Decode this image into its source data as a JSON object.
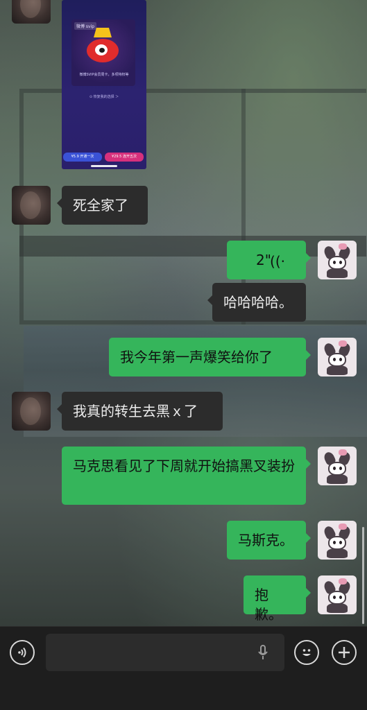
{
  "chat": {
    "screenshot": {
      "tag": "微博 svip",
      "promo": "微博SVIP会员周卡，多项特权等",
      "restore": "⊙ 恢复我的选择 ＞",
      "btn_once": "¥5.9 开通一次",
      "btn_five": "¥29.5 连开五次"
    },
    "messages": [
      {
        "sender": "other",
        "text": "死全家了"
      },
      {
        "sender": "me",
        "type": "voice",
        "duration": "2\"",
        "icon": "voice-wave-icon"
      },
      {
        "sender": "other",
        "text": "哈哈哈哈。"
      },
      {
        "sender": "me",
        "text": "我今年第一声爆笑给你了"
      },
      {
        "sender": "other",
        "text": "我真的转生去黑ｘ了"
      },
      {
        "sender": "me",
        "text": "马克思看见了下周就开始搞黑叉装扮"
      },
      {
        "sender": "me",
        "text": "马斯克。"
      },
      {
        "sender": "me",
        "text": "抱歉。"
      }
    ]
  },
  "input_bar": {
    "voice_toggle_icon": "voice-mode-icon",
    "input_value": "",
    "mic_icon": "microphone-icon",
    "emoji_icon": "emoji-icon",
    "plus_icon": "plus-icon"
  },
  "colors": {
    "bubble_out": "#35b55b",
    "bubble_in": "#2c2c2c",
    "bar": "#1e1e1e"
  }
}
